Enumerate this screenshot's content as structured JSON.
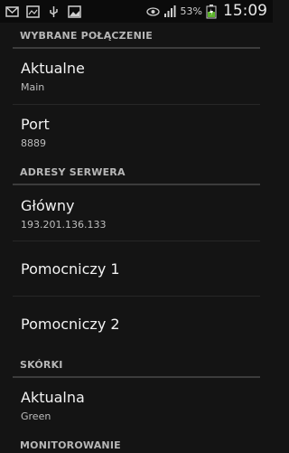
{
  "status_bar": {
    "icons_left": [
      "mail-icon",
      "image-icon",
      "usb-icon",
      "gallery-icon"
    ],
    "icons_right": [
      "eye-icon",
      "signal-icon",
      "battery-icon"
    ],
    "battery": "53%",
    "time": "15:09"
  },
  "sections": [
    {
      "header": "WYBRANE POŁĄCZENIE"
    },
    {
      "header": "ADRESY SERWERA"
    },
    {
      "header": "SKÓRKI"
    },
    {
      "header": "MONITOROWANIE"
    }
  ],
  "rows": [
    {
      "title": "Aktualne",
      "subtitle": "Main"
    },
    {
      "title": "Port",
      "subtitle": "8889"
    },
    {
      "title": "Główny",
      "subtitle": "193.201.136.133"
    },
    {
      "title": "Pomocniczy 1",
      "subtitle": ""
    },
    {
      "title": "Pomocniczy 2",
      "subtitle": ""
    },
    {
      "title": "Aktualna",
      "subtitle": "Green"
    }
  ]
}
